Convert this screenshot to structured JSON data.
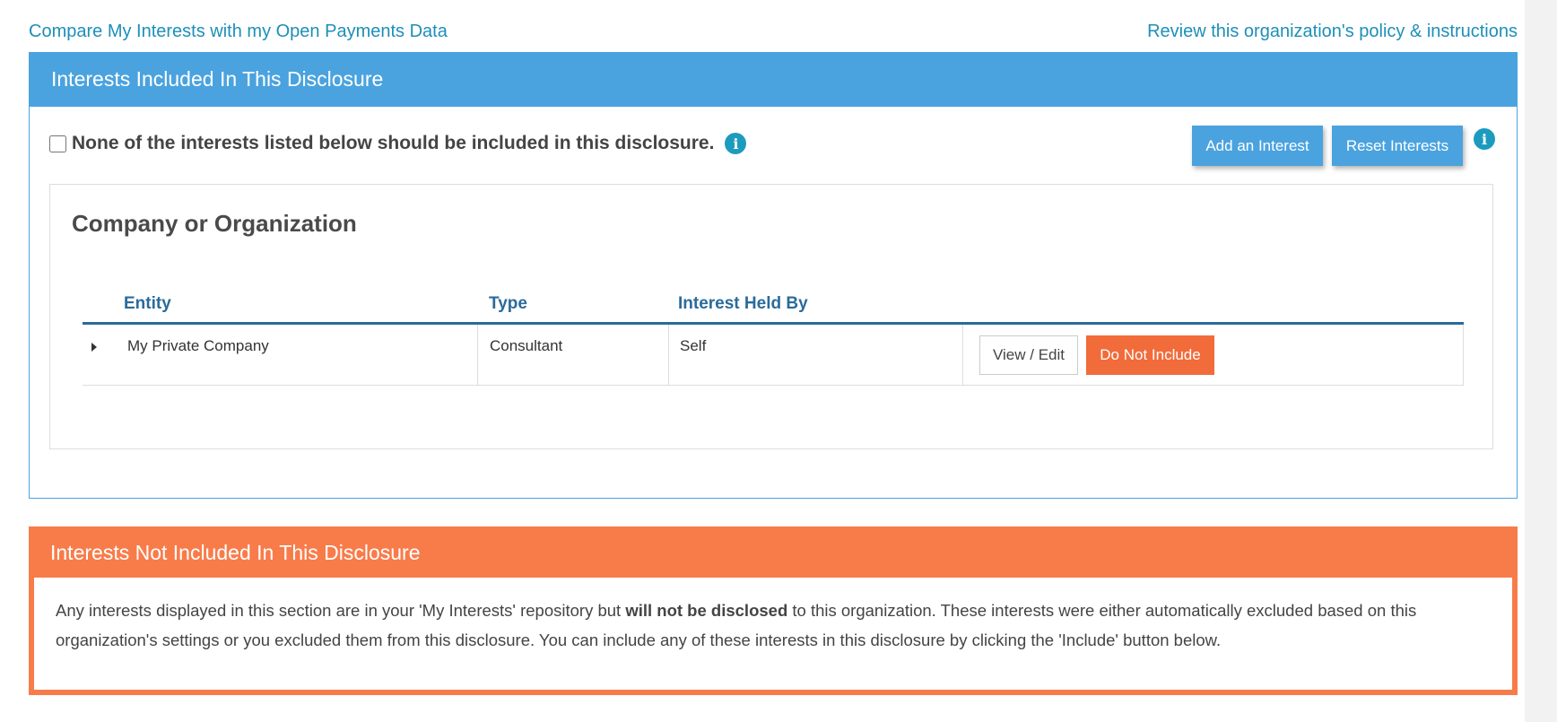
{
  "links": {
    "compare": "Compare My Interests with my Open Payments Data",
    "review_policy": "Review this organization's policy & instructions"
  },
  "included": {
    "header": "Interests Included In This Disclosure",
    "none_checkbox_label": "None of the interests listed below should be included in this disclosure.",
    "none_checked": false,
    "add_button": "Add an Interest",
    "reset_button": "Reset Interests",
    "group_title": "Company or Organization",
    "columns": [
      "Entity",
      "Type",
      "Interest Held By"
    ],
    "rows": [
      {
        "entity": "My Private Company",
        "type": "Consultant",
        "held_by": "Self",
        "view_edit": "View / Edit",
        "do_not_include": "Do Not Include"
      }
    ]
  },
  "excluded": {
    "header": "Interests Not Included In This Disclosure",
    "text_before": "Any interests displayed in this section are in your 'My Interests' repository but ",
    "text_bold": "will not be disclosed",
    "text_after": " to this organization. These interests were either automatically excluded based on this organization's settings or you excluded them from this disclosure. You can include any of these interests in this disclosure by clicking the 'Include' button below."
  },
  "icons": {
    "info": "info-icon",
    "expand": "caret-right-icon"
  },
  "colors": {
    "primary_blue": "#4aa3df",
    "link_blue": "#1d8fb8",
    "header_blue": "#2a6b9a",
    "orange": "#f87c4a",
    "do_not_include": "#f26b3a"
  }
}
